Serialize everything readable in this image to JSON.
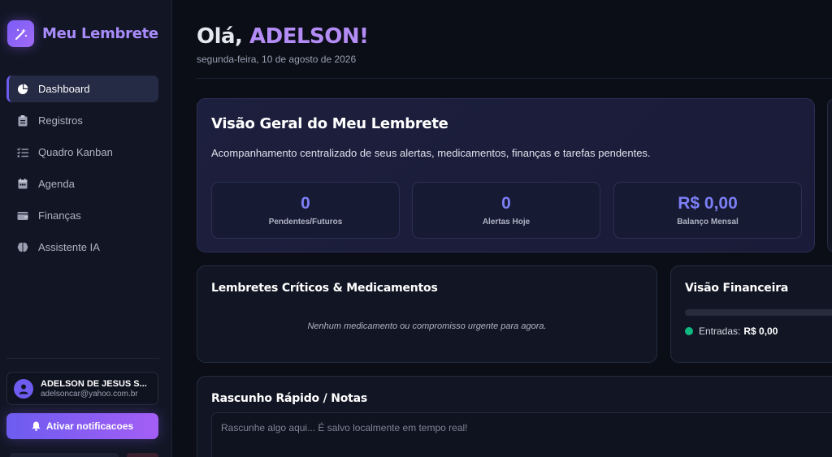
{
  "brand": {
    "name": "Meu Lembrete"
  },
  "sidebar": {
    "items": [
      {
        "label": "Dashboard",
        "icon": "pie-chart-icon",
        "active": true
      },
      {
        "label": "Registros",
        "icon": "clipboard-icon",
        "active": false
      },
      {
        "label": "Quadro Kanban",
        "icon": "list-check-icon",
        "active": false
      },
      {
        "label": "Agenda",
        "icon": "calendar-icon",
        "active": false
      },
      {
        "label": "Finanças",
        "icon": "wallet-icon",
        "active": false
      },
      {
        "label": "Assistente IA",
        "icon": "brain-icon",
        "active": false
      }
    ],
    "user": {
      "name": "ADELSON DE JESUS S...",
      "email": "adelsoncar@yahoo.com.br"
    },
    "notify_label": "Ativar notificacoes"
  },
  "header": {
    "greeting_prefix": "Olá, ",
    "user_name": "ADELSON!",
    "date": "segunda-feira, 10 de agosto de 2026"
  },
  "overview": {
    "title": "Visão Geral do Meu Lembrete",
    "description": "Acompanhamento centralizado de seus alertas, medicamentos, finanças e tarefas pendentes.",
    "stats": [
      {
        "value": "0",
        "label": "Pendentes/Futuros"
      },
      {
        "value": "0",
        "label": "Alertas Hoje"
      },
      {
        "value": "R$ 0,00",
        "label": "Balanço Mensal"
      }
    ]
  },
  "critical": {
    "title": "Lembretes Críticos & Medicamentos",
    "empty_message": "Nenhum medicamento ou compromisso urgente para agora."
  },
  "finance": {
    "title": "Visão Financeira",
    "income_label": "Entradas:",
    "income_value": "R$ 0,00"
  },
  "notes": {
    "title": "Rascunho Rápido / Notas",
    "placeholder": "Rascunhe algo aqui... É salvo localmente em tempo real!"
  },
  "colors": {
    "accent": "#6d5cf0",
    "accent_light": "#a78bfa",
    "income": "#10b981",
    "background": "#0b0e17"
  }
}
